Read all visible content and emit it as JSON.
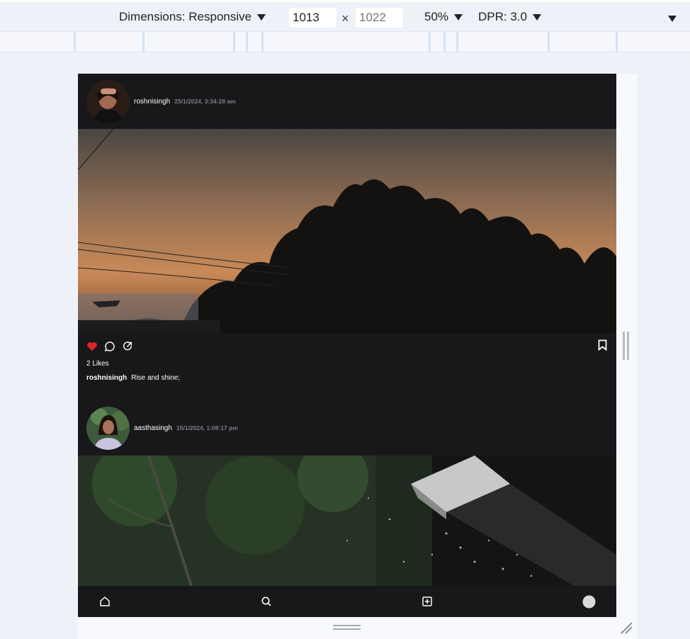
{
  "devtools": {
    "dimensions_label": "Dimensions: Responsive",
    "width_value": "1013",
    "height_placeholder": "1022",
    "times_symbol": "×",
    "zoom": "50%",
    "dpr": "DPR: 3.0"
  },
  "posts": [
    {
      "username": "roshnisingh",
      "timestamp": "25/1/2024, 3:34:28 am",
      "likes": "2 Likes",
      "caption_user": "roshnisingh",
      "caption_text": "Rise and shine;",
      "liked": true,
      "image": "sunset-trees"
    },
    {
      "username": "aasthasingh",
      "timestamp": "15/1/2024, 1:08:17 pm",
      "image": "rain-roof"
    }
  ],
  "nav": {
    "items": [
      "home-icon",
      "search-icon",
      "add-post-icon",
      "profile-avatar"
    ]
  },
  "colors": {
    "app_bg": "#18181b",
    "like_red": "#e0242b",
    "muted": "#7d7d85"
  }
}
